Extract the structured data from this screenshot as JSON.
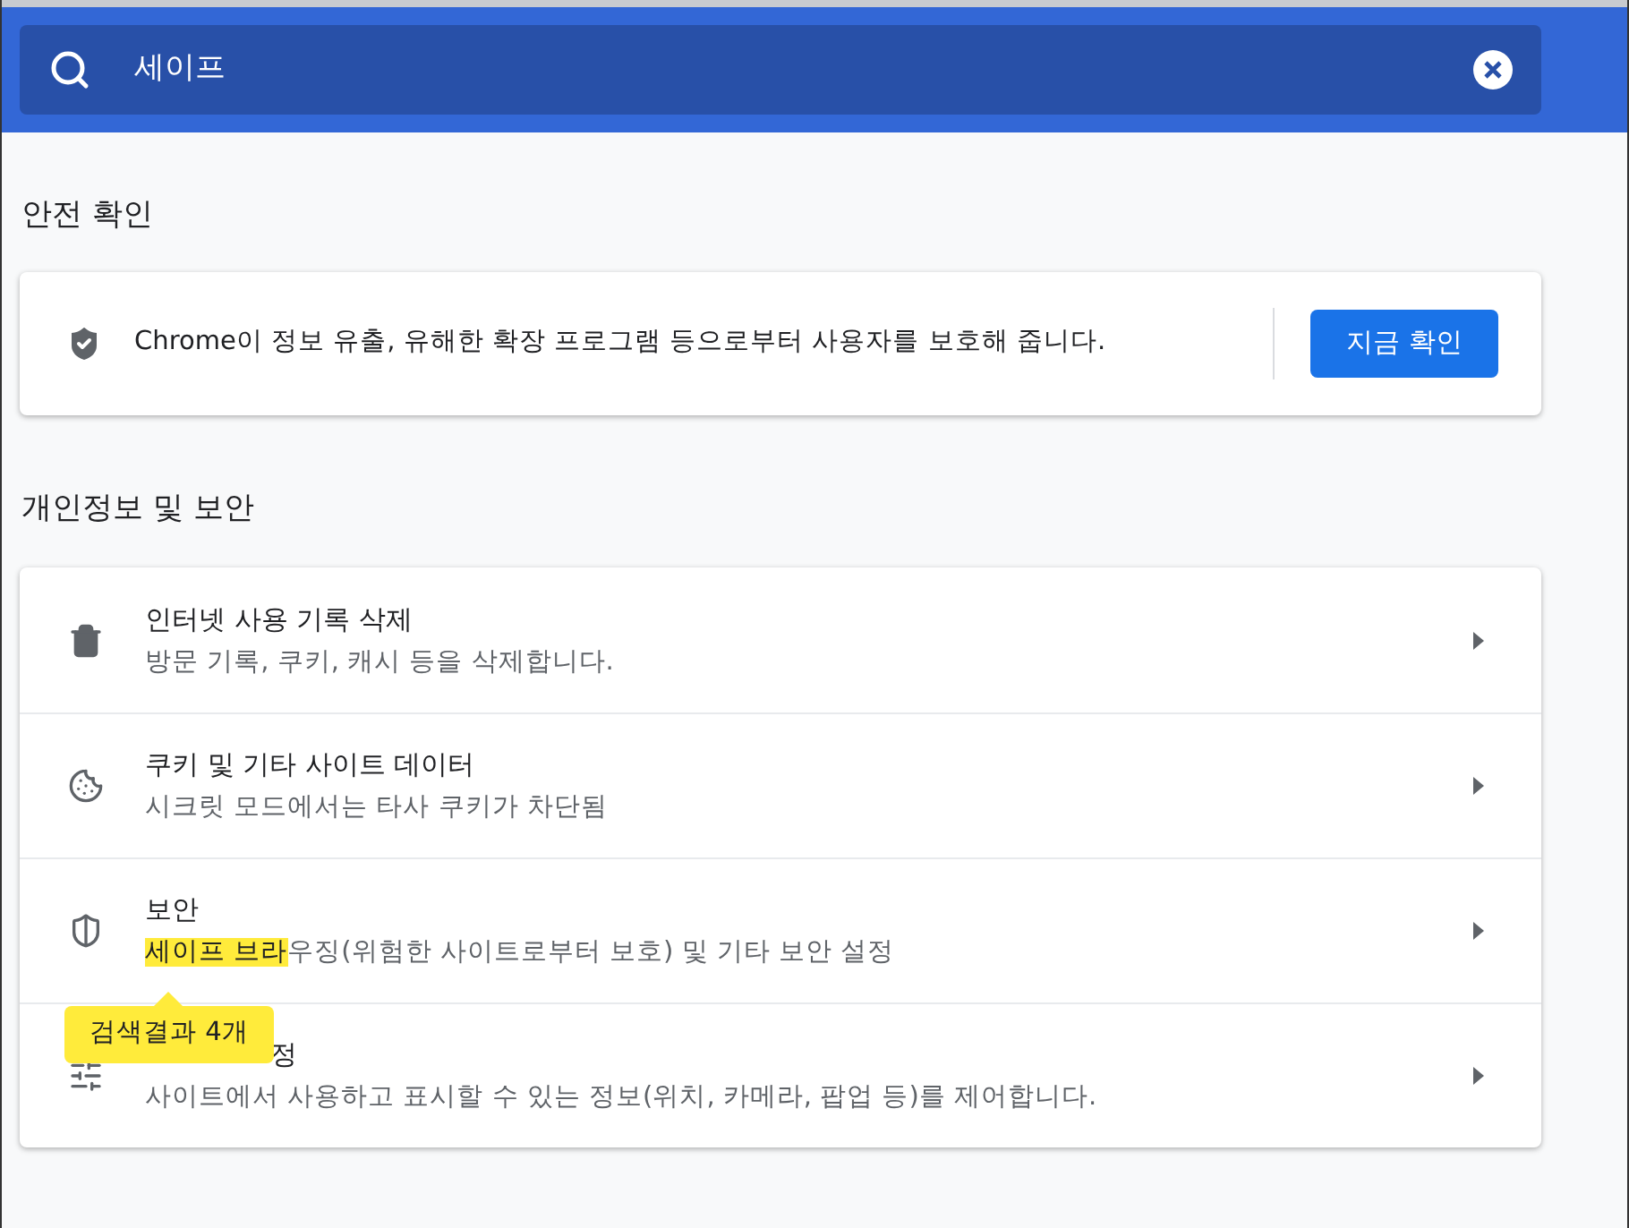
{
  "search": {
    "value": "세이프"
  },
  "safety_check": {
    "heading": "안전 확인",
    "text": "Chrome이 정보 유출, 유해한 확장 프로그램 등으로부터 사용자를 보호해 줍니다.",
    "button": "지금 확인"
  },
  "privacy": {
    "heading": "개인정보 및 보안",
    "rows": [
      {
        "kind": "trash",
        "title": "인터넷 사용 기록 삭제",
        "description": [
          {
            "text": "방문 기록, 쿠키, 캐시 등을 삭제합니다.",
            "highlighted": false
          }
        ]
      },
      {
        "kind": "cookie",
        "title": "쿠키 및 기타 사이트 데이터",
        "description": [
          {
            "text": "시크릿 모드에서는 타사 쿠키가 차단됨",
            "highlighted": false
          }
        ]
      },
      {
        "kind": "shield",
        "title": "보안",
        "description": [
          {
            "text": "세이프 브라",
            "highlighted": true
          },
          {
            "text": "우징(위험한 사이트로부터 보호) 및 기타 보안 설정",
            "highlighted": false
          }
        ]
      },
      {
        "kind": "sliders",
        "title": "정",
        "title_covered": true,
        "description": [
          {
            "text": "사이트에서 사용하고 표시할 수 있는 정보(위치, 카메라, 팝업 등)를 제어합니다.",
            "highlighted": false
          }
        ]
      }
    ]
  },
  "tooltip": {
    "text": "검색결과 4개"
  }
}
